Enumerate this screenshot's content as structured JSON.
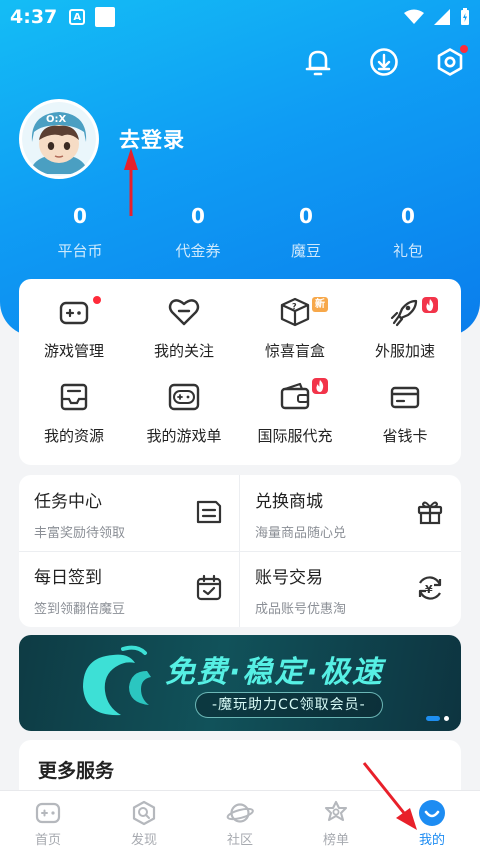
{
  "status_bar": {
    "time": "4:37",
    "badge_letter": "A"
  },
  "header": {
    "login_text": "去登录",
    "icons": [
      "bell-icon",
      "download-icon",
      "settings-hex-icon"
    ]
  },
  "stats": [
    {
      "value": "0",
      "label": "平台币"
    },
    {
      "value": "0",
      "label": "代金券"
    },
    {
      "value": "0",
      "label": "魔豆"
    },
    {
      "value": "0",
      "label": "礼包"
    }
  ],
  "grid": [
    {
      "label": "游戏管理",
      "icon": "gamepad-icon",
      "badge": "red-dot"
    },
    {
      "label": "我的关注",
      "icon": "heart-icon"
    },
    {
      "label": "惊喜盲盒",
      "icon": "mystery-box-icon",
      "badge": "新"
    },
    {
      "label": "外服加速",
      "icon": "rocket-icon",
      "badge": "fire"
    },
    {
      "label": "我的资源",
      "icon": "inbox-icon"
    },
    {
      "label": "我的游戏单",
      "icon": "game-list-icon"
    },
    {
      "label": "国际服代充",
      "icon": "wallet-icon",
      "badge": "fire"
    },
    {
      "label": "省钱卡",
      "icon": "card-icon"
    }
  ],
  "tasks": [
    {
      "title": "任务中心",
      "subtitle": "丰富奖励待领取",
      "icon": "task-note-icon"
    },
    {
      "title": "兑换商城",
      "subtitle": "海量商品随心兑",
      "icon": "gift-icon"
    },
    {
      "title": "每日签到",
      "subtitle": "签到领翻倍魔豆",
      "icon": "calendar-check-icon"
    },
    {
      "title": "账号交易",
      "subtitle": "成品账号优惠淘",
      "icon": "yen-exchange-icon"
    }
  ],
  "banner": {
    "title": "免费·稳定·极速",
    "subtitle": "-魔玩助力CC领取会员-"
  },
  "more_services": {
    "title": "更多服务"
  },
  "bottom_nav": [
    {
      "label": "首页",
      "icon": "home-gamepad-icon"
    },
    {
      "label": "发现",
      "icon": "discover-icon"
    },
    {
      "label": "社区",
      "icon": "planet-icon"
    },
    {
      "label": "榜单",
      "icon": "ranking-icon"
    },
    {
      "label": "我的",
      "icon": "profile-icon",
      "active": true
    }
  ],
  "colors": {
    "brand_blue": "#0f9cf4",
    "active_blue": "#1d8cf2",
    "alert_red": "#ff2b3a",
    "arrow_red": "#e8202a"
  }
}
